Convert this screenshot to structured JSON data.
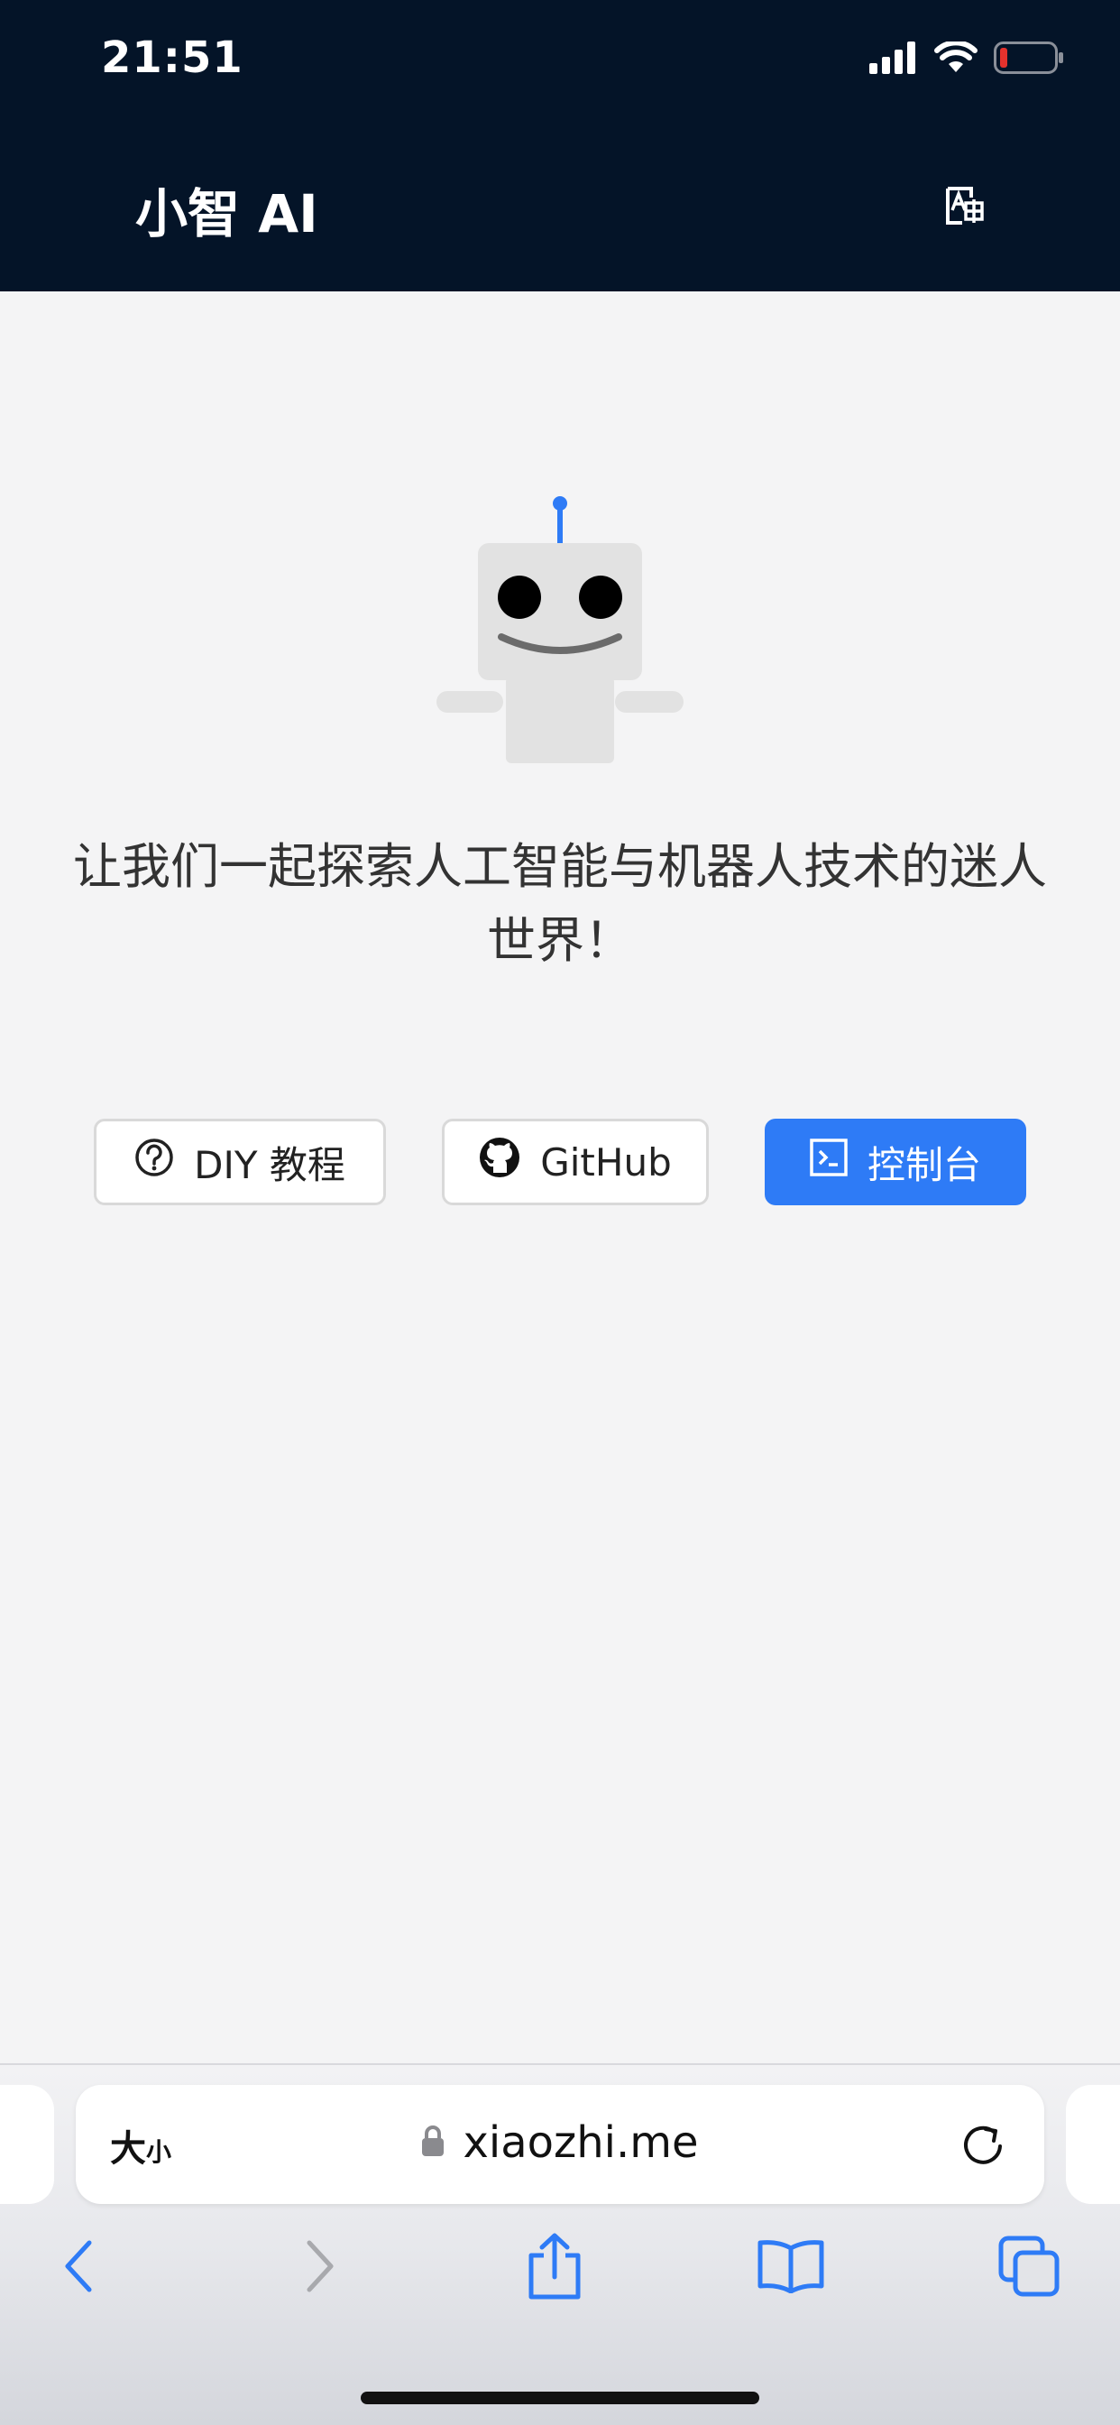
{
  "status_bar": {
    "time": "21:51"
  },
  "header": {
    "title": "小智 AI"
  },
  "main": {
    "tagline": "让我们一起探索人工智能与机器人技术的迷人世界！",
    "buttons": [
      {
        "label": "DIY 教程",
        "icon": "help-circle-icon"
      },
      {
        "label": "GitHub",
        "icon": "github-icon"
      },
      {
        "label": "控制台",
        "icon": "terminal-icon"
      }
    ]
  },
  "browser": {
    "text_size_label_large": "大",
    "text_size_label_small": "小",
    "url": "xiaozhi.me"
  },
  "colors": {
    "header_bg": "#041428",
    "accent": "#2e7bf6",
    "page_bg": "#f4f4f5",
    "battery_low": "#e5322d"
  }
}
